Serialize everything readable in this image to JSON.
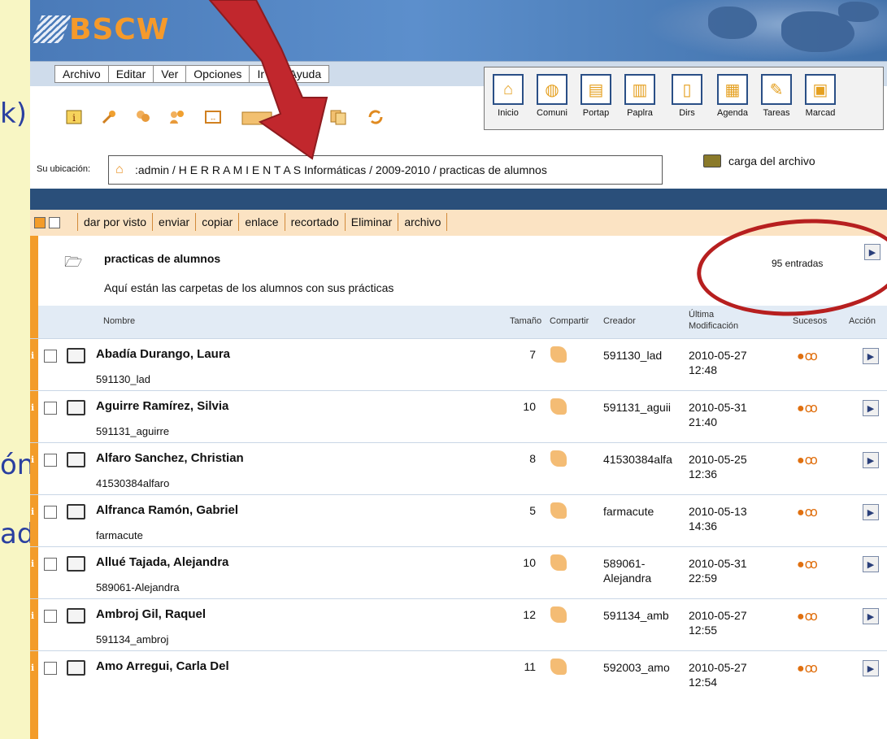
{
  "slide": {
    "side_texts": [
      "k)",
      "ón",
      "ad"
    ]
  },
  "app": {
    "logo": "BSCW"
  },
  "menu": [
    "Archivo",
    "Editar",
    "Ver",
    "Opciones",
    "Ir a",
    "Ayuda"
  ],
  "nav": [
    "Inicio",
    "Comuni",
    "Portap",
    "Paplra",
    "Dirs",
    "Agenda",
    "Tareas",
    "Marcad"
  ],
  "toolbar_icons": [
    "info-icon",
    "key-icon",
    "share-icon",
    "people-icon",
    "move-icon",
    "folder-icon",
    "copy-icon",
    "refresh-icon"
  ],
  "location": {
    "label": "Su ubicación:",
    "path": ":admin / H E R R A M I E N T A S Informáticas / 2009-2010 / practicas de alumnos",
    "upload": "carga del archivo"
  },
  "actions": [
    "dar por visto",
    "enviar",
    "copiar",
    "enlace",
    "recortado",
    "Eliminar",
    "archivo"
  ],
  "folder": {
    "title": "practicas de alumnos",
    "description": "Aquí están las carpetas de los alumnos con sus prácticas",
    "count": "95 entradas"
  },
  "columns": {
    "name": "Nombre",
    "size": "Tamaño",
    "share": "Compartir",
    "creator": "Creador",
    "modified": "Última Modificación",
    "events": "Sucesos",
    "action": "Acción"
  },
  "rows": [
    {
      "name": "Abadía Durango, Laura",
      "sub": "591130_lad",
      "size": "7",
      "creator": "591130_lad",
      "date": "2010-05-27",
      "time": "12:48"
    },
    {
      "name": "Aguirre Ramírez, Silvia",
      "sub": "591131_aguirre",
      "size": "10",
      "creator": "591131_aguii",
      "date": "2010-05-31",
      "time": "21:40"
    },
    {
      "name": "Alfaro Sanchez, Christian",
      "sub": "41530384alfaro",
      "size": "8",
      "creator": "41530384alfa",
      "date": "2010-05-25",
      "time": "12:36"
    },
    {
      "name": "Alfranca Ramón, Gabriel",
      "sub": "farmacute",
      "size": "5",
      "creator": "farmacute",
      "date": "2010-05-13",
      "time": "14:36"
    },
    {
      "name": "Allué Tajada, Alejandra",
      "sub": "589061-Alejandra",
      "size": "10",
      "creator": "589061- Alejandra",
      "date": "2010-05-31",
      "time": "22:59"
    },
    {
      "name": "Ambroj Gil, Raquel",
      "sub": "591134_ambroj",
      "size": "12",
      "creator": "591134_amb",
      "date": "2010-05-27",
      "time": "12:55"
    },
    {
      "name": "Amo Arregui, Carla Del",
      "sub": "",
      "size": "11",
      "creator": "592003_amo",
      "date": "2010-05-27",
      "time": "12:54"
    }
  ],
  "colors": {
    "accent_orange": "#f39c2a",
    "annotation_red": "#b71f1f",
    "header_blue": "#2a4f7a"
  }
}
